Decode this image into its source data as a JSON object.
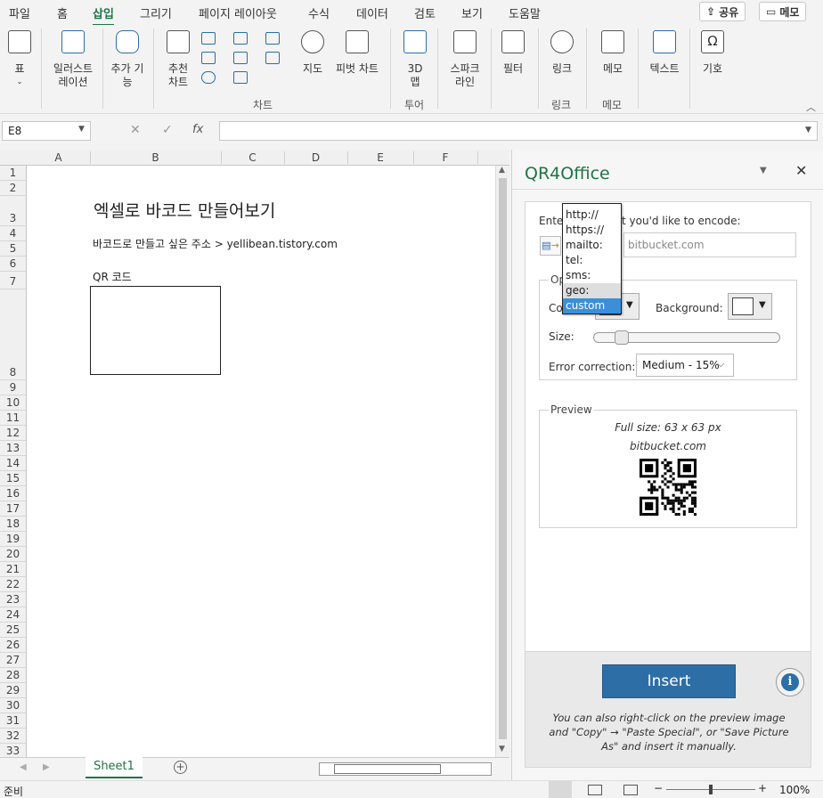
{
  "ribbon_tabs": [
    "파일",
    "홈",
    "삽입",
    "그리기",
    "페이지 레이아웃",
    "수식",
    "데이터",
    "검토",
    "보기",
    "도움말"
  ],
  "active_tab": "삽입",
  "top_buttons": {
    "share": "공유",
    "comment": "메모"
  },
  "ribbon": {
    "table": "표",
    "illustrations": [
      "일러스트",
      "레이션"
    ],
    "addins": [
      "추가 기",
      "능"
    ],
    "recommended_charts": [
      "추천",
      "차트"
    ],
    "map": "지도",
    "pivot_chart": "피벗 차트",
    "map3d": [
      "3D",
      "맵"
    ],
    "sparkline": [
      "스파크",
      "라인"
    ],
    "filter": "필터",
    "link": "링크",
    "memo": "메모",
    "text": "텍스트",
    "symbol": "기호",
    "group_chart": "차트",
    "group_tour": "투어",
    "group_link": "링크",
    "group_memo": "메모"
  },
  "formula_bar": {
    "name_box": "E8",
    "fx": "fx",
    "value": ""
  },
  "columns": [
    "A",
    "B",
    "C",
    "D",
    "E",
    "F"
  ],
  "rows": [
    "1",
    "2",
    "3",
    "4",
    "5",
    "6",
    "7",
    "8",
    "9",
    "10",
    "11",
    "12",
    "13",
    "14",
    "15",
    "16",
    "17",
    "18",
    "19",
    "20",
    "21",
    "22",
    "23",
    "24",
    "25",
    "26",
    "27",
    "28",
    "29",
    "30",
    "31",
    "32",
    "33"
  ],
  "cells": {
    "title": "엑셀로 바코드 만들어보기",
    "subtitle": "바코드로 만들고 싶은 주소 > yellibean.tistory.com",
    "qr_label": "QR 코드"
  },
  "sheet_tab": "Sheet1",
  "status": {
    "ready": "준비",
    "zoom": "100%"
  },
  "pane": {
    "title": "QR4Office",
    "encode_label_left": "Enter",
    "encode_label_right": "t you'd like to encode:",
    "url_value": "bitbucket.com",
    "options_legend_partial": "Op",
    "color_label_partial": "Co",
    "background_label": "Background:",
    "size_label": "Size:",
    "error_label": "Error correction:",
    "error_value": "Medium - 15%",
    "preview_legend": "Preview",
    "full_size": "Full size: 63 x 63 px",
    "preview_text": "bitbucket.com",
    "insert": "Insert",
    "footnote": "You can also right-click on the preview image and \"Copy\" → \"Paste Special\", or \"Save Picture As\" and insert it manually.",
    "protocol_options": [
      "http://",
      "https://",
      "mailto:",
      "tel:",
      "sms:",
      "geo:",
      "custom"
    ],
    "selected_option": "custom",
    "size_level": 0.12
  },
  "colors": {
    "excel_green": "#217346",
    "insert_blue": "#2e6ea6",
    "selection_blue": "#3b8fd9"
  }
}
